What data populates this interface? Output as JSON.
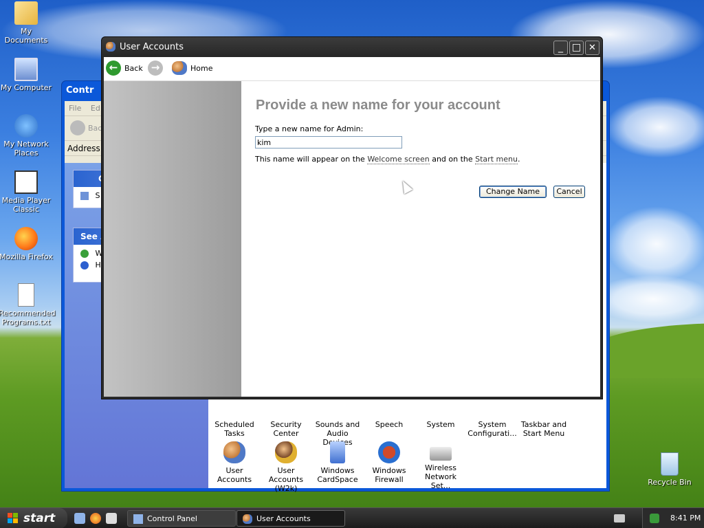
{
  "desktop": {
    "icons": [
      {
        "label": "My Documents"
      },
      {
        "label": "My Computer"
      },
      {
        "label": "My Network Places"
      },
      {
        "label": "Media Player Classic"
      },
      {
        "label": "Mozilla Firefox"
      },
      {
        "label": "Recommended Programs.txt"
      },
      {
        "label": "Recycle Bin"
      }
    ]
  },
  "control_panel": {
    "title": "Contr",
    "menu": "File",
    "menu2": "Ed",
    "back_label": "Bac",
    "address_label": "Address",
    "box1_head": "Co",
    "box1_item": "S",
    "box2_head": "See A",
    "box2_item1": "W",
    "box2_item2": "H",
    "items_row1": [
      "Scheduled Tasks",
      "Security Center",
      "Sounds and Audio Devices",
      "Speech",
      "System",
      "System Configurati...",
      "Taskbar and Start Menu"
    ],
    "items_row2": [
      "User Accounts",
      "User Accounts (W2k)",
      "Windows CardSpace",
      "Windows Firewall",
      "Wireless Network Set..."
    ]
  },
  "user_accounts": {
    "title": "User Accounts",
    "nav": {
      "back": "Back",
      "home": "Home"
    },
    "heading": "Provide a new name for your account",
    "prompt": "Type a new name for Admin:",
    "input_value": "kim",
    "hint_prefix": "This name will appear on the ",
    "hint_link1": "Welcome screen",
    "hint_mid": " and on the ",
    "hint_link2": "Start menu",
    "hint_suffix": ".",
    "change_button": "Change Name",
    "cancel_button": "Cancel",
    "window_buttons": {
      "minimize": "_",
      "maximize": "□",
      "close": "✕"
    }
  },
  "taskbar": {
    "start_label": "start",
    "tasks": [
      {
        "label": "Control Panel",
        "active": false
      },
      {
        "label": "User Accounts",
        "active": true
      }
    ],
    "clock": "8:41 PM"
  },
  "colors": {
    "titlebar_dark": "#2a2a2a",
    "heading_gray": "#8b8b8b",
    "cp_blue": "#0b58d9"
  }
}
